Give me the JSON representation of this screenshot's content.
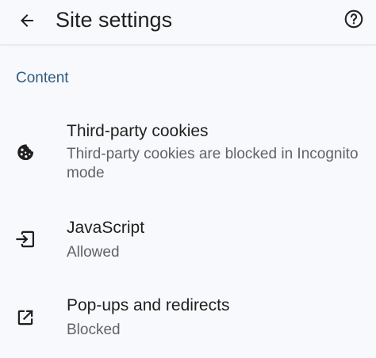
{
  "header": {
    "title": "Site settings",
    "back_icon": "arrow-back-icon",
    "help_icon": "help-circle-icon"
  },
  "section": {
    "label": "Content"
  },
  "items": [
    {
      "title": "Third-party cookies",
      "summary": "Third-party cookies are blocked in Incognito mode",
      "icon": "cookie-icon"
    },
    {
      "title": "JavaScript",
      "summary": "Allowed",
      "icon": "javascript-icon"
    },
    {
      "title": "Pop-ups and redirects",
      "summary": "Blocked",
      "icon": "popup-open-icon"
    }
  ],
  "colors": {
    "background": "#f8f9fc",
    "section_accent": "#2e5d80",
    "primary_text": "#1f1f1f",
    "secondary_text": "#5f6368"
  }
}
